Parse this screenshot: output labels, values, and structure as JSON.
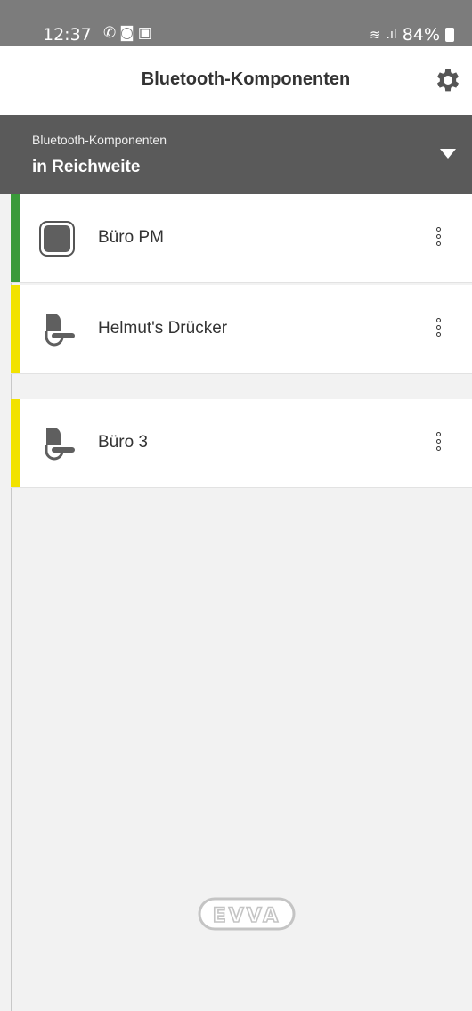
{
  "status": {
    "time": "12:37",
    "notif_icons": [
      "missed-call-icon",
      "teams-icon",
      "outlook-icon"
    ],
    "battery": "84%"
  },
  "app_bar": {
    "title": "Bluetooth-Komponenten",
    "settings_icon": "gear-icon"
  },
  "filter": {
    "label": "Bluetooth-Komponenten",
    "value": "in Reichweite"
  },
  "devices": [
    {
      "name": "Büro PM",
      "icon": "cylinder-icon",
      "status_color": "#3a9a3a"
    },
    {
      "name": "Helmut's Drücker",
      "icon": "door-handle-icon",
      "status_color": "#f2e200"
    },
    {
      "name": "Büro 3",
      "icon": "door-handle-icon",
      "status_color": "#f2e200"
    }
  ],
  "footer": {
    "logo": "EVVA"
  }
}
